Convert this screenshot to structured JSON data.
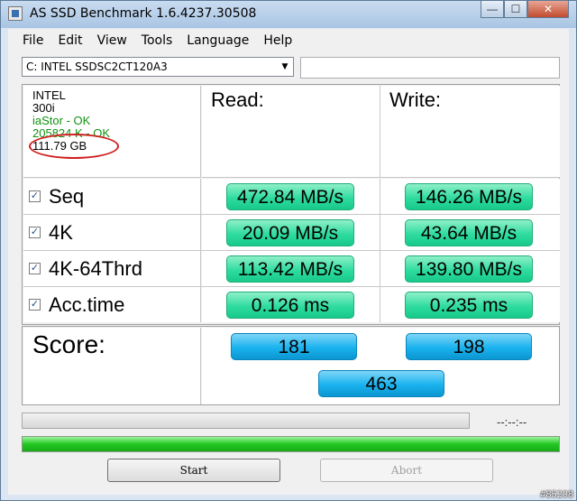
{
  "window": {
    "title": "AS SSD Benchmark 1.6.4237.30508",
    "minimize": "—",
    "maximize": "☐",
    "close": "✕"
  },
  "menu": [
    "File",
    "Edit",
    "View",
    "Tools",
    "Language",
    "Help"
  ],
  "drive": {
    "selected": "C: INTEL SSDSC2CT120A3",
    "arrow": "▼"
  },
  "info": {
    "vendor": "INTEL",
    "firmware": "300i",
    "driver": "iaStor - OK",
    "alignment": "205824 K - OK",
    "size": "111.79 GB"
  },
  "headers": {
    "read": "Read:",
    "write": "Write:"
  },
  "check_mark": "✓",
  "rows": [
    {
      "label": "Seq",
      "read": "472.84 MB/s",
      "write": "146.26 MB/s"
    },
    {
      "label": "4K",
      "read": "20.09 MB/s",
      "write": "43.64 MB/s"
    },
    {
      "label": "4K-64Thrd",
      "read": "113.42 MB/s",
      "write": "139.80 MB/s"
    },
    {
      "label": "Acc.time",
      "read": "0.126 ms",
      "write": "0.235 ms"
    }
  ],
  "score": {
    "label": "Score:",
    "read": "181",
    "write": "198",
    "total": "463"
  },
  "progress": {
    "elapsed": "--:--:--",
    "progress_fill": 0,
    "status_fill": 1.0
  },
  "buttons": {
    "start": "Start",
    "abort": "Abort"
  },
  "watermark": "#85208",
  "colors": {
    "result_green": "#2fdca0",
    "score_blue": "#19b2ee",
    "progress_green": "#22c822",
    "annotation_red": "#d02020"
  }
}
